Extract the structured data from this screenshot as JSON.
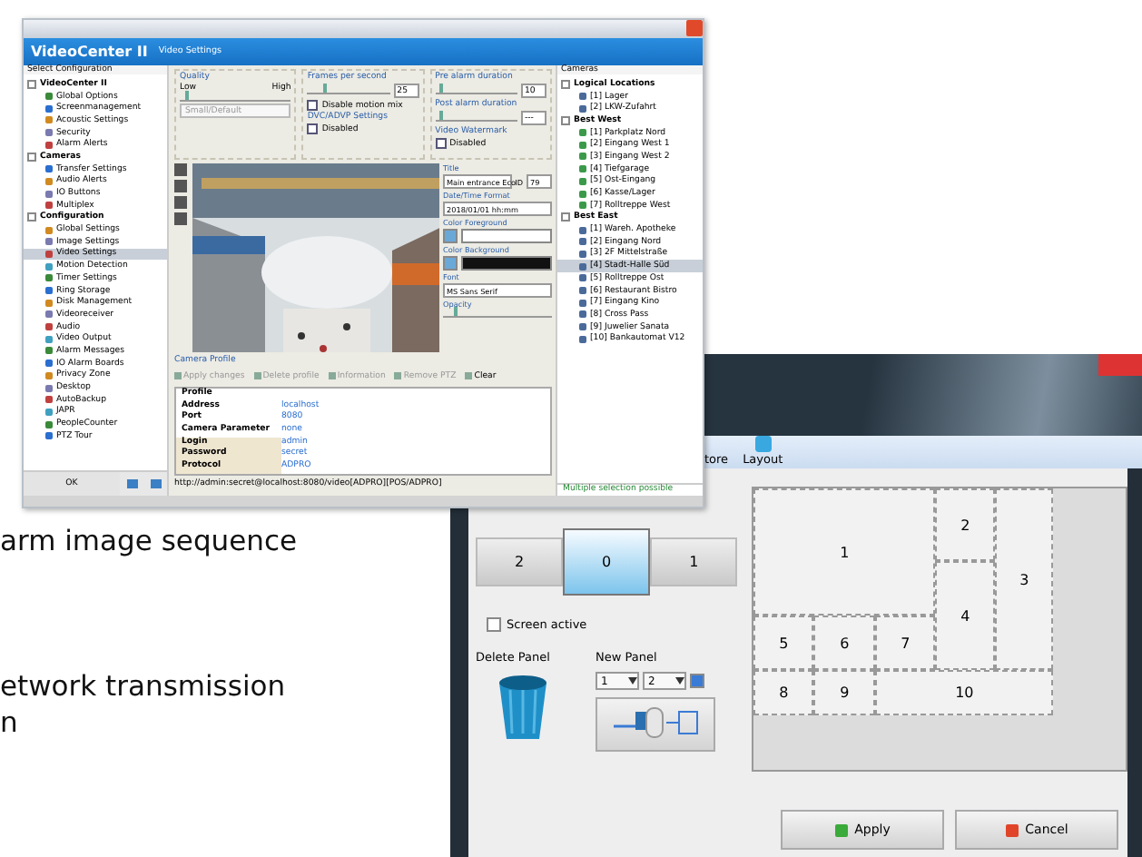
{
  "caption_lines": [
    {
      "text": "arm image sequence"
    },
    {
      "text": "etwork transmission"
    },
    {
      "text": "n"
    }
  ],
  "settings_window": {
    "app_title": "VideoCenter II",
    "page_title": "Video Settings",
    "tree_header": "Select Configuration",
    "tree": [
      {
        "label": "VideoCenter II",
        "expanded": true,
        "selected": false,
        "children": [
          {
            "label": "Global Options",
            "selected": false
          },
          {
            "label": "Screenmanagement",
            "selected": false
          },
          {
            "label": "Acoustic Settings",
            "selected": false
          },
          {
            "label": "Security",
            "selected": false
          },
          {
            "label": "Alarm Alerts",
            "selected": false
          }
        ]
      },
      {
        "label": "Cameras",
        "expanded": true,
        "selected": false,
        "children": [
          {
            "label": "Transfer Settings",
            "selected": false
          },
          {
            "label": "Audio Alerts",
            "selected": false
          },
          {
            "label": "IO Buttons",
            "selected": false
          },
          {
            "label": "Multiplex",
            "selected": false
          }
        ]
      },
      {
        "label": "Configuration",
        "expanded": true,
        "selected": false,
        "children": [
          {
            "label": "Global Settings",
            "selected": false
          },
          {
            "label": "Image Settings",
            "selected": false
          },
          {
            "label": "Video Settings",
            "selected": true
          },
          {
            "label": "Motion Detection",
            "selected": false
          },
          {
            "label": "Timer Settings",
            "selected": false
          },
          {
            "label": "Ring Storage",
            "selected": false
          },
          {
            "label": "Disk Management",
            "selected": false
          },
          {
            "label": "Videoreceiver",
            "selected": false
          },
          {
            "label": "Audio",
            "selected": false
          },
          {
            "label": "Video Output",
            "selected": false
          },
          {
            "label": "Alarm Messages",
            "selected": false
          },
          {
            "label": "IO Alarm Boards",
            "selected": false
          },
          {
            "label": "Privacy Zone",
            "selected": false
          },
          {
            "label": "Desktop",
            "selected": false
          },
          {
            "label": "AutoBackup",
            "selected": false
          },
          {
            "label": "JAPR",
            "selected": false
          },
          {
            "label": "PeopleCounter",
            "selected": false
          },
          {
            "label": "PTZ Tour",
            "selected": false
          }
        ]
      }
    ],
    "tree_footer_button": "OK",
    "quality": {
      "title": "Quality",
      "low": "Low",
      "high": "High",
      "level": 0.05,
      "select": "Small/Default"
    },
    "fps": {
      "title": "Frames per second",
      "value": "25",
      "checkbox": {
        "label": "Disable motion mix",
        "checked": false
      }
    },
    "pre_alarm": {
      "title": "Pre alarm duration",
      "level": 0.05,
      "value": "10"
    },
    "post_alarm": {
      "title": "Post alarm duration",
      "level": 0.05,
      "value": "---"
    },
    "dvc": {
      "title": "DVC/ADVP Settings",
      "checkbox": {
        "label": "Disabled",
        "checked": false
      }
    },
    "watermark": {
      "title": "Video Watermark",
      "checkbox": {
        "label": "Disabled",
        "checked": false
      }
    },
    "overlay": {
      "title_label": "Title",
      "title_value": "Main entrance Eco",
      "id_label": "ID",
      "id_value": "79",
      "date_label": "Date/Time Format",
      "date_value": "2018/01/01 hh:mm",
      "fg_label": "Color Foreground",
      "bg_label": "Color Background",
      "font_label": "Font",
      "font_value": "MS Sans Serif",
      "opacity": {
        "label": "Opacity",
        "level": 0.1
      }
    },
    "profile": {
      "title": "Camera Profile",
      "tools": [
        {
          "label": "Apply changes",
          "disabled": true
        },
        {
          "label": "Delete profile",
          "disabled": true
        },
        {
          "label": "Information",
          "disabled": true
        },
        {
          "label": "Remove PTZ",
          "disabled": true
        },
        {
          "label": "Clear",
          "disabled": false
        }
      ],
      "rows": [
        {
          "label": "Profile",
          "value": ""
        },
        {
          "label": "Address",
          "value": "localhost"
        },
        {
          "label": "Port",
          "value": "8080"
        },
        {
          "label": "Camera Parameter",
          "value": "none"
        },
        {
          "label": "Login",
          "value": "admin"
        },
        {
          "label": "Password",
          "value": "secret"
        },
        {
          "label": "Protocol",
          "value": "ADPRO"
        }
      ],
      "url": "http://admin:secret@localhost:8080/video[ADPRO][POS/ADPRO]"
    },
    "cameras_header": "Cameras",
    "cameras": [
      {
        "label": "Logical Locations",
        "children": [
          {
            "label": "[1] Lager",
            "selected": false
          },
          {
            "label": "[2] LKW-Zufahrt",
            "selected": false
          }
        ]
      },
      {
        "label": "Best West",
        "children": [
          {
            "label": "[1] Parkplatz Nord",
            "selected": false
          },
          {
            "label": "[2] Eingang West 1",
            "selected": false
          },
          {
            "label": "[3] Eingang West 2",
            "selected": false
          },
          {
            "label": "[4] Tiefgarage",
            "selected": false
          },
          {
            "label": "[5] Ost-Eingang",
            "selected": false
          },
          {
            "label": "[6] Kasse/Lager",
            "selected": false
          },
          {
            "label": "[7] Rolltreppe West",
            "selected": false
          }
        ]
      },
      {
        "label": "Best East",
        "children": [
          {
            "label": "[1] Wareh. Apotheke",
            "selected": false
          },
          {
            "label": "[2] Eingang Nord",
            "selected": false
          },
          {
            "label": "[3] 2F Mittelstraße",
            "selected": false
          },
          {
            "label": "[4] Stadt-Halle Süd",
            "selected": true
          },
          {
            "label": "[5] Rolltreppe Ost",
            "selected": false
          },
          {
            "label": "[6] Restaurant Bistro",
            "selected": false
          },
          {
            "label": "[7] Eingang Kino",
            "selected": false
          },
          {
            "label": "[8] Cross Pass",
            "selected": false
          },
          {
            "label": "[9] Juwelier Sanata",
            "selected": false
          },
          {
            "label": "[10] Bankautomat V12",
            "selected": false
          }
        ]
      }
    ],
    "cameras_status": "Multiple selection possible"
  },
  "layout_window": {
    "toolbar": [
      {
        "label": "tore"
      },
      {
        "label": "Layout"
      }
    ],
    "screens": [
      {
        "label": "2",
        "selected": false
      },
      {
        "label": "0",
        "selected": true
      },
      {
        "label": "1",
        "selected": false
      }
    ],
    "screen_active": {
      "label": "Screen active",
      "checked": false
    },
    "delete_label": "Delete Panel",
    "new_label": "New Panel",
    "new_cols": "1",
    "new_rows": "2",
    "new_check": true,
    "panels": [
      "1",
      "2",
      "3",
      "4",
      "5",
      "6",
      "7",
      "8",
      "9",
      "10"
    ],
    "buttons": [
      {
        "label": "Apply",
        "kind": "apply"
      },
      {
        "label": "Cancel",
        "kind": "cancel"
      }
    ]
  }
}
